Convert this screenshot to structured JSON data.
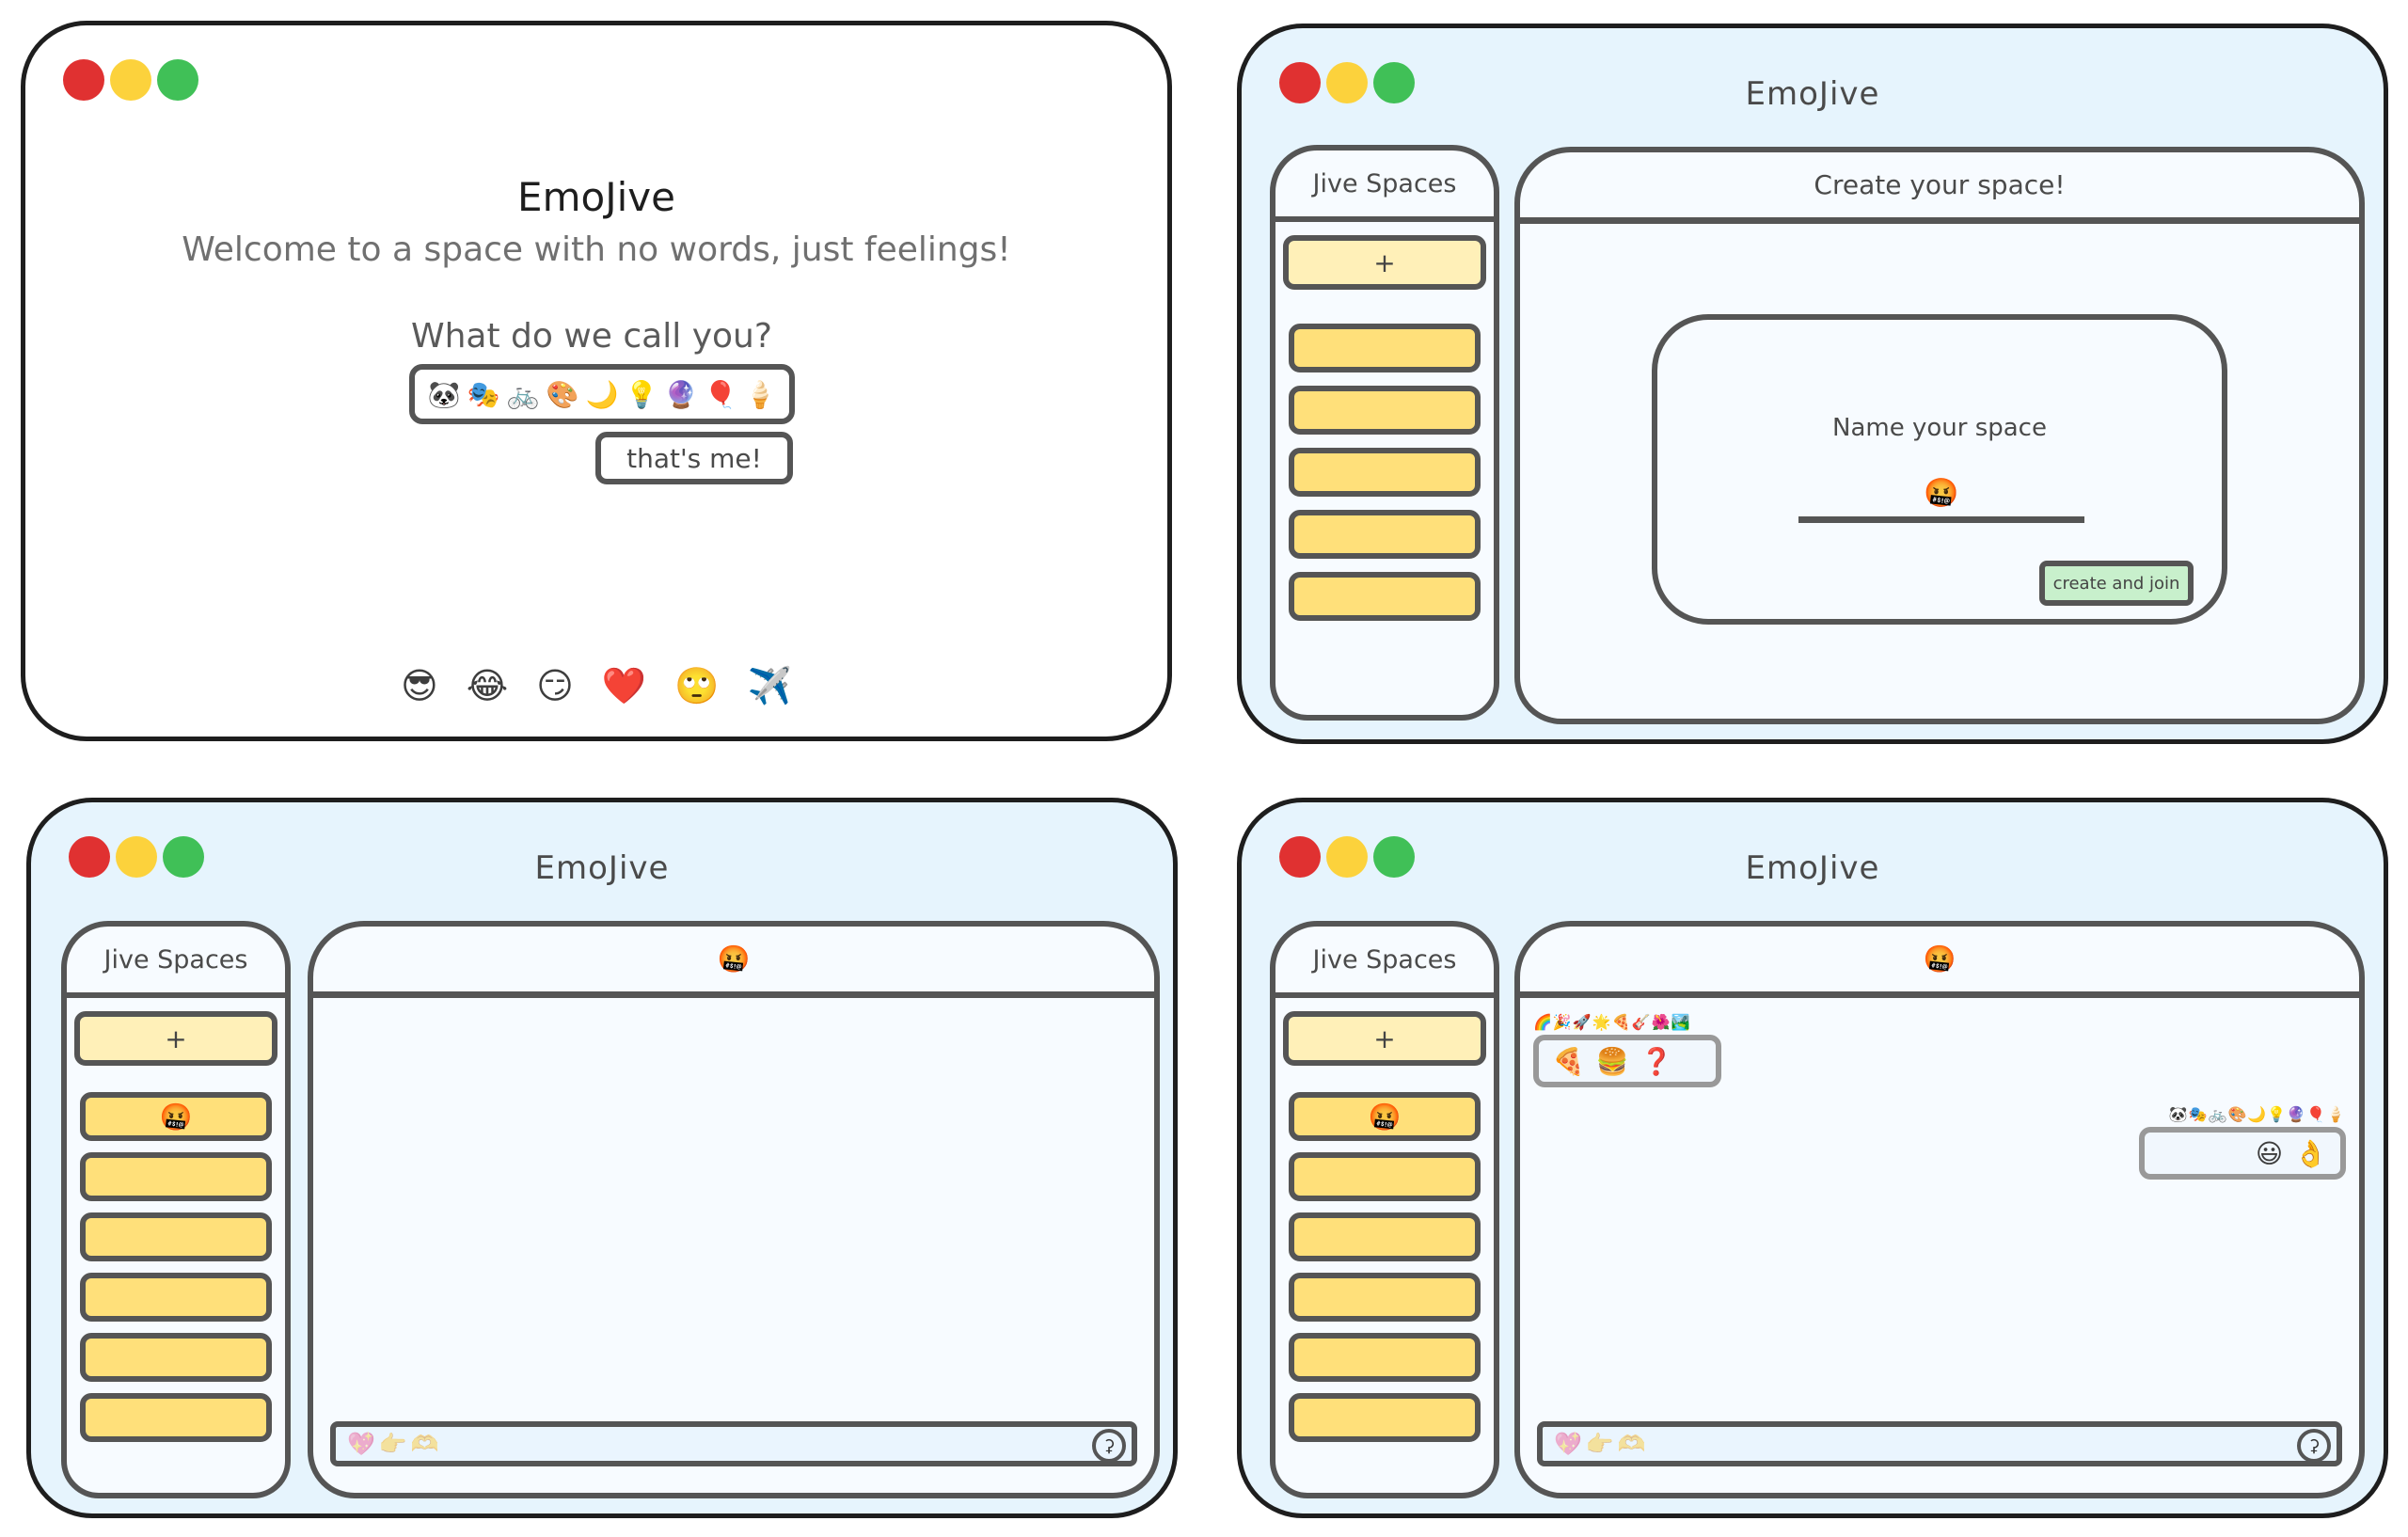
{
  "app_name": "EmoJive",
  "landing": {
    "title": "EmoJive",
    "subtitle": "Welcome to a space with no words, just feelings!",
    "prompt": "What do we call you?",
    "name_value": [
      "🐼",
      "🎭",
      "🚲",
      "🎨",
      "🌙",
      "💡",
      "🔮",
      "🎈",
      "🍦"
    ],
    "confirm_label": "that's me!",
    "footer_emojis": [
      "😎",
      "😂",
      "😏",
      "❤️",
      "🙄",
      "✈️"
    ]
  },
  "sidebar": {
    "title": "Jive Spaces",
    "add_label": "+"
  },
  "create_space": {
    "header": "Create your space!",
    "label": "Name your space",
    "input_value": "🤬",
    "submit_label": "create and join",
    "spaces": [
      "",
      "",
      "",
      "",
      ""
    ]
  },
  "chat_empty": {
    "header_emoji": "🤬",
    "spaces": [
      "🤬",
      "",
      "",
      "",
      "",
      ""
    ],
    "input_placeholder": "💖👉🫶",
    "send_icon": "mic-icon"
  },
  "chat_active": {
    "header_emoji": "🤬",
    "spaces": [
      "🤬",
      "",
      "",
      "",
      "",
      ""
    ],
    "messages": [
      {
        "sender": "🌈🎉🚀🌟🍕🎸🌺🏞️",
        "text": [
          "🍕",
          "🍔",
          "❓"
        ],
        "side": "left"
      },
      {
        "sender": "🐼🎭🚲🎨🌙💡🔮🎈🍦",
        "text": [
          "😃",
          "👌"
        ],
        "side": "right"
      }
    ],
    "input_placeholder": "💖👉🫶",
    "send_icon": "mic-icon"
  },
  "colors": {
    "traffic_red": "#e03131",
    "traffic_yellow": "#fcd23c",
    "traffic_green": "#40c057",
    "space_item": "#ffe07a",
    "add_button": "#fff0b8",
    "create_button": "#c8f0cc",
    "window_bg": "#e6f4fd"
  }
}
